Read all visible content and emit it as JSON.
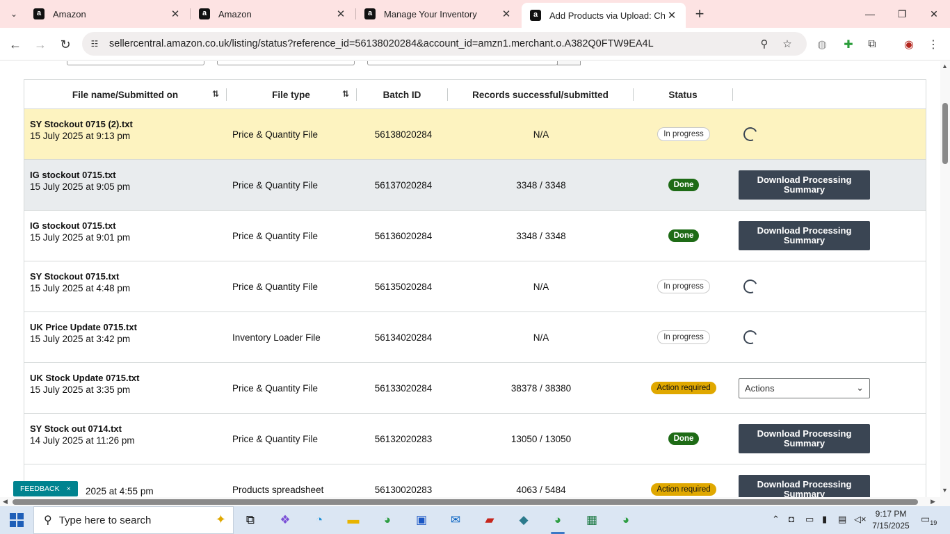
{
  "browser": {
    "tabs": [
      {
        "title": "Amazon",
        "active": false
      },
      {
        "title": "Amazon",
        "active": false
      },
      {
        "title": "Manage Your Inventory",
        "active": false
      },
      {
        "title": "Add Products via Upload: Chec",
        "active": true
      }
    ],
    "url": "sellercentral.amazon.co.uk/listing/status?reference_id=56138020284&account_id=amzn1.merchant.o.A382Q0FTW9EA4L"
  },
  "table": {
    "headers": {
      "file": "File name/Submitted on",
      "type": "File type",
      "batch": "Batch ID",
      "records": "Records successful/submitted",
      "status": "Status"
    },
    "rows": [
      {
        "name": "SY Stockout 0715 (2).txt",
        "date": "15 July 2025 at 9:13 pm",
        "type": "Price & Quantity File",
        "batch": "56138020284",
        "records": "N/A",
        "status": "In progress",
        "action": "spinner"
      },
      {
        "name": "IG stockout 0715.txt",
        "date": "15 July 2025 at 9:05 pm",
        "type": "Price & Quantity File",
        "batch": "56137020284",
        "records": "3348 / 3348",
        "status": "Done",
        "action": "Download Processing Summary"
      },
      {
        "name": "IG stockout 0715.txt",
        "date": "15 July 2025 at 9:01 pm",
        "type": "Price & Quantity File",
        "batch": "56136020284",
        "records": "3348 / 3348",
        "status": "Done",
        "action": "Download Processing Summary"
      },
      {
        "name": "SY Stockout 0715.txt",
        "date": "15 July 2025 at 4:48 pm",
        "type": "Price & Quantity File",
        "batch": "56135020284",
        "records": "N/A",
        "status": "In progress",
        "action": "spinner"
      },
      {
        "name": "UK Price Update 0715.txt",
        "date": "15 July 2025 at 3:42 pm",
        "type": "Inventory Loader File",
        "batch": "56134020284",
        "records": "N/A",
        "status": "In progress",
        "action": "spinner"
      },
      {
        "name": "UK Stock Update 0715.txt",
        "date": "15 July 2025 at 3:35 pm",
        "type": "Price & Quantity File",
        "batch": "56133020284",
        "records": "38378 / 38380",
        "status": "Action required",
        "action": "Actions"
      },
      {
        "name": "SY Stock out 0714.txt",
        "date": "14 July 2025 at 11:26 pm",
        "type": "Price & Quantity File",
        "batch": "56132020283",
        "records": "13050 / 13050",
        "status": "Done",
        "action": "Download Processing Summary"
      },
      {
        "name": "",
        "date": "2025 at 4:55 pm",
        "type": "Products spreadsheet",
        "batch": "56130020283",
        "records": "4063 / 5484",
        "status": "Action required",
        "action": "Download Processing Summary"
      }
    ]
  },
  "feedback": {
    "label": "FEEDBACK",
    "close": "×"
  },
  "taskbar": {
    "search_placeholder": "Type here to search",
    "time": "9:17 PM",
    "date": "7/15/2025",
    "notifications": "19"
  }
}
